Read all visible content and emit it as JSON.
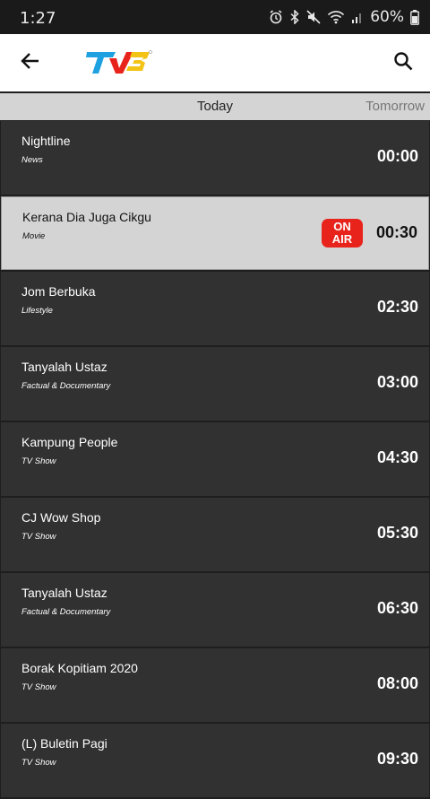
{
  "status_bar": {
    "time": "1:27",
    "battery": "60%"
  },
  "app_bar": {
    "logo_text": "TV3"
  },
  "tabs": [
    {
      "label": "Today",
      "selected": true
    },
    {
      "label": "Tomorrow",
      "selected": false
    }
  ],
  "on_air": {
    "line1": "ON",
    "line2": "AIR"
  },
  "schedule": [
    {
      "title": "Nightline",
      "genre": "News",
      "time": "00:00"
    },
    {
      "title": "Kerana Dia Juga Cikgu",
      "genre": "Movie",
      "time": "00:30",
      "on_air": true
    },
    {
      "title": "Jom Berbuka",
      "genre": "Lifestyle",
      "time": "02:30"
    },
    {
      "title": "Tanyalah Ustaz",
      "genre": "Factual & Documentary",
      "time": "03:00"
    },
    {
      "title": "Kampung People",
      "genre": "TV Show",
      "time": "04:30"
    },
    {
      "title": "CJ Wow Shop",
      "genre": "TV Show",
      "time": "05:30"
    },
    {
      "title": "Tanyalah Ustaz",
      "genre": "Factual & Documentary",
      "time": "06:30"
    },
    {
      "title": "Borak Kopitiam 2020",
      "genre": "TV Show",
      "time": "08:00"
    },
    {
      "title": "(L) Buletin Pagi",
      "genre": "TV Show",
      "time": "09:30"
    }
  ],
  "colors": {
    "on_air_red": "#e8231b",
    "row_dark": "#313131",
    "row_active": "#d4d4d4"
  }
}
